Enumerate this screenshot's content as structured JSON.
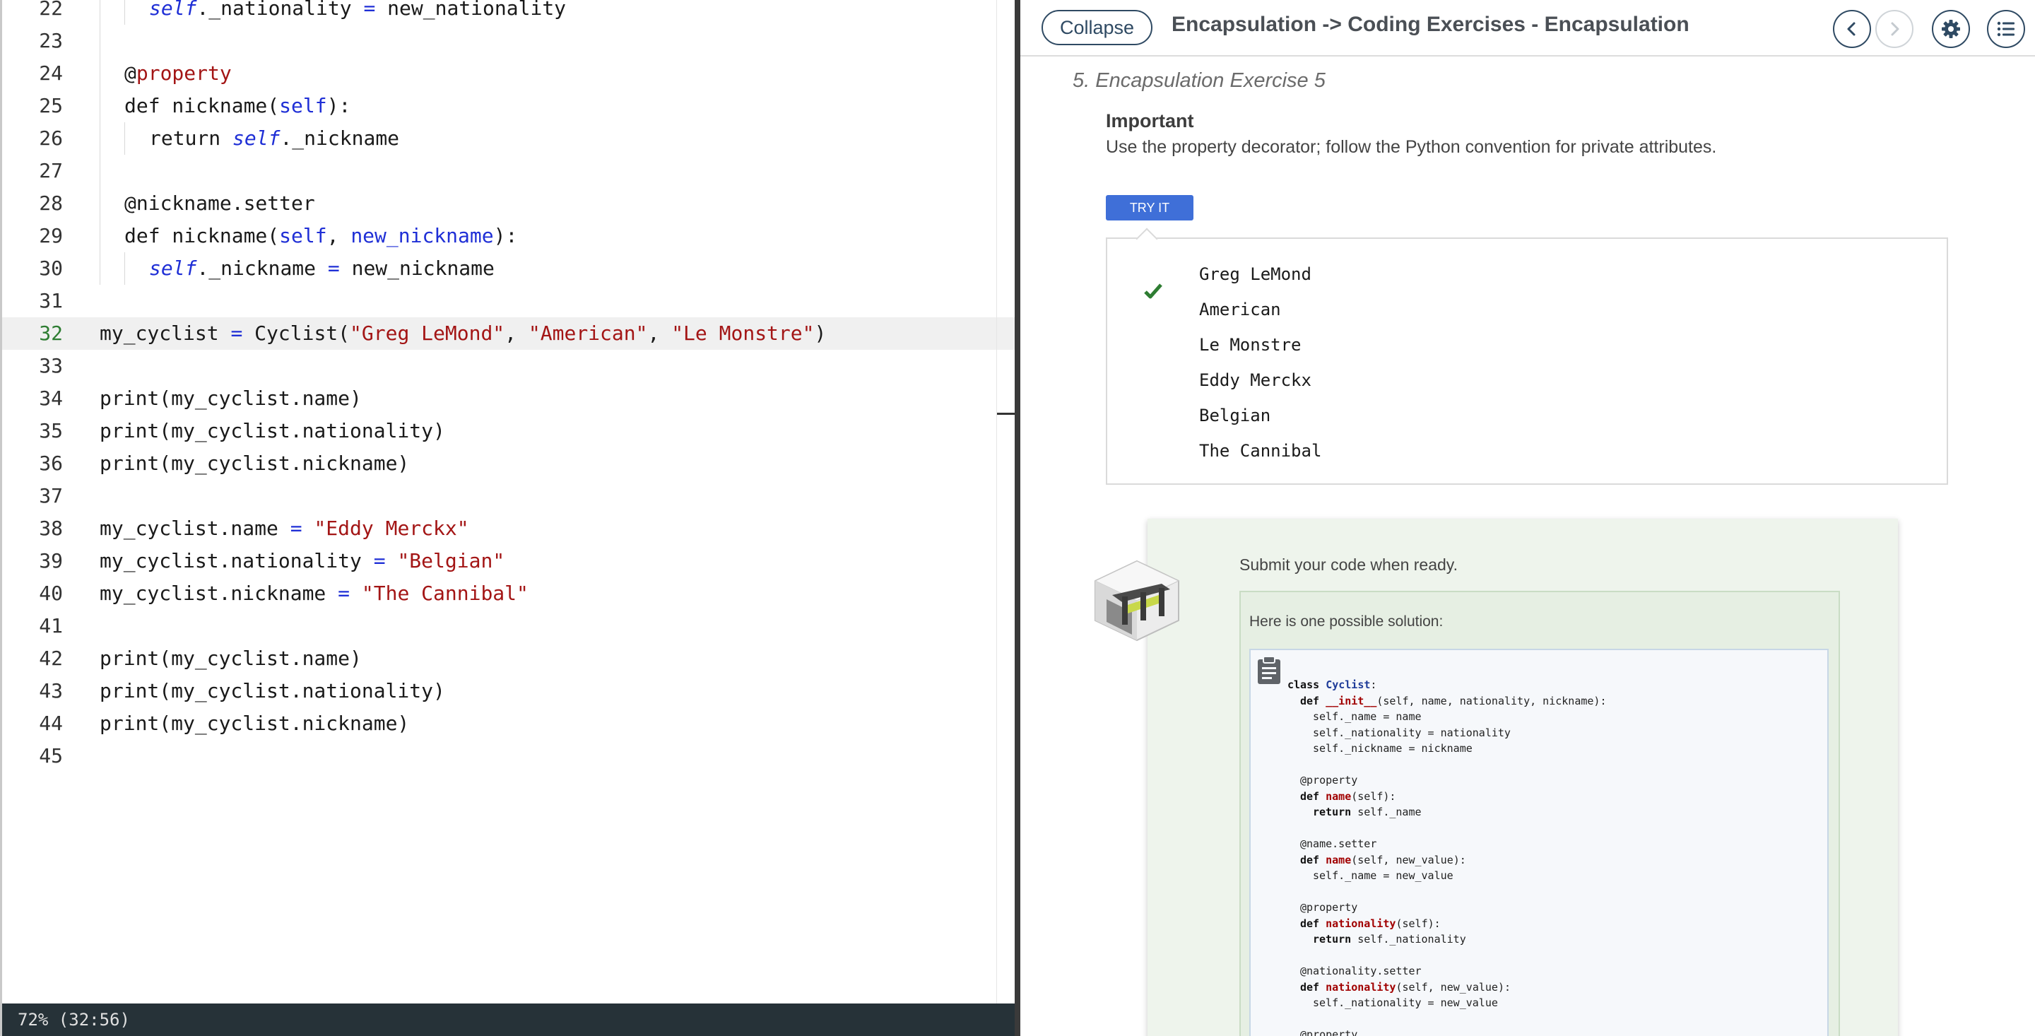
{
  "editor": {
    "lines": [
      {
        "n": "22",
        "indent": 2,
        "tokens": [
          {
            "t": "self",
            "c": "self"
          },
          {
            "t": "._nationality ",
            "c": ""
          },
          {
            "t": "=",
            "c": "op"
          },
          {
            "t": " new_nationality",
            "c": ""
          }
        ]
      },
      {
        "n": "23",
        "indent": 1,
        "tokens": []
      },
      {
        "n": "24",
        "indent": 1,
        "tokens": [
          {
            "t": "@",
            "c": ""
          },
          {
            "t": "property",
            "c": "dec"
          }
        ]
      },
      {
        "n": "25",
        "indent": 1,
        "tokens": [
          {
            "t": "def nickname(",
            "c": ""
          },
          {
            "t": "self",
            "c": "blue"
          },
          {
            "t": "):",
            "c": ""
          }
        ]
      },
      {
        "n": "26",
        "indent": 2,
        "tokens": [
          {
            "t": "return ",
            "c": ""
          },
          {
            "t": "self",
            "c": "self"
          },
          {
            "t": "._nickname",
            "c": ""
          }
        ]
      },
      {
        "n": "27",
        "indent": 1,
        "tokens": []
      },
      {
        "n": "28",
        "indent": 1,
        "tokens": [
          {
            "t": "@nickname.setter",
            "c": ""
          }
        ]
      },
      {
        "n": "29",
        "indent": 1,
        "tokens": [
          {
            "t": "def nickname(",
            "c": ""
          },
          {
            "t": "self",
            "c": "blue"
          },
          {
            "t": ", ",
            "c": ""
          },
          {
            "t": "new_nickname",
            "c": "blue"
          },
          {
            "t": "):",
            "c": ""
          }
        ]
      },
      {
        "n": "30",
        "indent": 2,
        "tokens": [
          {
            "t": "self",
            "c": "self"
          },
          {
            "t": "._nickname ",
            "c": ""
          },
          {
            "t": "=",
            "c": "op"
          },
          {
            "t": " new_nickname",
            "c": ""
          }
        ]
      },
      {
        "n": "31",
        "indent": 0,
        "tokens": []
      },
      {
        "n": "32",
        "indent": 0,
        "active": true,
        "tokens": [
          {
            "t": "my_cyclist ",
            "c": ""
          },
          {
            "t": "=",
            "c": "op"
          },
          {
            "t": " Cyclist(",
            "c": ""
          },
          {
            "t": "\"Greg LeMond\"",
            "c": "str"
          },
          {
            "t": ", ",
            "c": ""
          },
          {
            "t": "\"American\"",
            "c": "str"
          },
          {
            "t": ", ",
            "c": ""
          },
          {
            "t": "\"Le Monstre\"",
            "c": "str"
          },
          {
            "t": ")",
            "c": ""
          }
        ]
      },
      {
        "n": "33",
        "indent": 0,
        "tokens": []
      },
      {
        "n": "34",
        "indent": 0,
        "tokens": [
          {
            "t": "print(my_cyclist.name)",
            "c": ""
          }
        ]
      },
      {
        "n": "35",
        "indent": 0,
        "tokens": [
          {
            "t": "print(my_cyclist.nationality)",
            "c": ""
          }
        ]
      },
      {
        "n": "36",
        "indent": 0,
        "tokens": [
          {
            "t": "print(my_cyclist.nickname)",
            "c": ""
          }
        ]
      },
      {
        "n": "37",
        "indent": 0,
        "tokens": []
      },
      {
        "n": "38",
        "indent": 0,
        "tokens": [
          {
            "t": "my_cyclist.name ",
            "c": ""
          },
          {
            "t": "=",
            "c": "op"
          },
          {
            "t": " ",
            "c": ""
          },
          {
            "t": "\"Eddy Merckx\"",
            "c": "str"
          }
        ]
      },
      {
        "n": "39",
        "indent": 0,
        "tokens": [
          {
            "t": "my_cyclist.nationality ",
            "c": ""
          },
          {
            "t": "=",
            "c": "op"
          },
          {
            "t": " ",
            "c": ""
          },
          {
            "t": "\"Belgian\"",
            "c": "str"
          }
        ]
      },
      {
        "n": "40",
        "indent": 0,
        "tokens": [
          {
            "t": "my_cyclist.nickname ",
            "c": ""
          },
          {
            "t": "=",
            "c": "op"
          },
          {
            "t": " ",
            "c": ""
          },
          {
            "t": "\"The Cannibal\"",
            "c": "str"
          }
        ]
      },
      {
        "n": "41",
        "indent": 0,
        "tokens": []
      },
      {
        "n": "42",
        "indent": 0,
        "tokens": [
          {
            "t": "print(my_cyclist.name)",
            "c": ""
          }
        ]
      },
      {
        "n": "43",
        "indent": 0,
        "tokens": [
          {
            "t": "print(my_cyclist.nationality)",
            "c": ""
          }
        ]
      },
      {
        "n": "44",
        "indent": 0,
        "tokens": [
          {
            "t": "print(my_cyclist.nickname)",
            "c": ""
          }
        ]
      },
      {
        "n": "45",
        "indent": 0,
        "tokens": []
      }
    ],
    "status": "72%  (32:56)"
  },
  "guide": {
    "collapse_label": "Collapse",
    "title": "Encapsulation -> Coding Exercises - Encapsulation",
    "section_title": "5. Encapsulation Exercise 5",
    "important_heading": "Important",
    "important_text": "Use the property decorator; follow the Python convention for private attributes.",
    "try_it_label": "TRY IT",
    "output_lines": [
      "Greg LeMond",
      "American",
      "Le Monstre",
      "Eddy Merckx",
      "Belgian",
      "The Cannibal"
    ],
    "submit_text": "Submit your code when ready.",
    "solution_label": "Here is one possible solution:",
    "solution_lines": [
      {
        "indent": 0,
        "tokens": [
          {
            "t": "class ",
            "c": "kw"
          },
          {
            "t": "Cyclist",
            "c": "cls"
          },
          {
            "t": ":",
            "c": ""
          }
        ]
      },
      {
        "indent": 1,
        "tokens": [
          {
            "t": "def ",
            "c": "kw"
          },
          {
            "t": "__init__",
            "c": "fn"
          },
          {
            "t": "(self, name, nationality, nickname):",
            "c": ""
          }
        ]
      },
      {
        "indent": 2,
        "tokens": [
          {
            "t": "self._name = name",
            "c": ""
          }
        ]
      },
      {
        "indent": 2,
        "tokens": [
          {
            "t": "self._nationality = nationality",
            "c": ""
          }
        ]
      },
      {
        "indent": 2,
        "tokens": [
          {
            "t": "self._nickname = nickname",
            "c": ""
          }
        ]
      },
      {
        "indent": 0,
        "tokens": []
      },
      {
        "indent": 1,
        "tokens": [
          {
            "t": "@property",
            "c": ""
          }
        ]
      },
      {
        "indent": 1,
        "tokens": [
          {
            "t": "def ",
            "c": "kw"
          },
          {
            "t": "name",
            "c": "fn"
          },
          {
            "t": "(self):",
            "c": ""
          }
        ]
      },
      {
        "indent": 2,
        "tokens": [
          {
            "t": "return ",
            "c": "kw"
          },
          {
            "t": "self._name",
            "c": ""
          }
        ]
      },
      {
        "indent": 0,
        "tokens": []
      },
      {
        "indent": 1,
        "tokens": [
          {
            "t": "@name.setter",
            "c": ""
          }
        ]
      },
      {
        "indent": 1,
        "tokens": [
          {
            "t": "def ",
            "c": "kw"
          },
          {
            "t": "name",
            "c": "fn"
          },
          {
            "t": "(self, new_value):",
            "c": ""
          }
        ]
      },
      {
        "indent": 2,
        "tokens": [
          {
            "t": "self._name = new_value",
            "c": ""
          }
        ]
      },
      {
        "indent": 0,
        "tokens": []
      },
      {
        "indent": 1,
        "tokens": [
          {
            "t": "@property",
            "c": ""
          }
        ]
      },
      {
        "indent": 1,
        "tokens": [
          {
            "t": "def ",
            "c": "kw"
          },
          {
            "t": "nationality",
            "c": "fn"
          },
          {
            "t": "(self):",
            "c": ""
          }
        ]
      },
      {
        "indent": 2,
        "tokens": [
          {
            "t": "return ",
            "c": "kw"
          },
          {
            "t": "self._nationality",
            "c": ""
          }
        ]
      },
      {
        "indent": 0,
        "tokens": []
      },
      {
        "indent": 1,
        "tokens": [
          {
            "t": "@nationality.setter",
            "c": ""
          }
        ]
      },
      {
        "indent": 1,
        "tokens": [
          {
            "t": "def ",
            "c": "kw"
          },
          {
            "t": "nationality",
            "c": "fn"
          },
          {
            "t": "(self, new_value):",
            "c": ""
          }
        ]
      },
      {
        "indent": 2,
        "tokens": [
          {
            "t": "self._nationality = new_value",
            "c": ""
          }
        ]
      },
      {
        "indent": 0,
        "tokens": []
      },
      {
        "indent": 1,
        "tokens": [
          {
            "t": "@property",
            "c": ""
          }
        ]
      }
    ]
  },
  "icons": {
    "prev": "chevron-left-icon",
    "next": "chevron-right-icon",
    "settings": "gear-icon",
    "toc": "list-icon",
    "check": "check-icon",
    "clipboard": "clipboard-icon",
    "robot": "robot-icon"
  },
  "colors": {
    "accent": "#3f6fd8",
    "dark_blue": "#2f4a63",
    "keyword_blue": "#1f2fd6",
    "string_red": "#a31515",
    "success_green": "#2e7d32"
  }
}
